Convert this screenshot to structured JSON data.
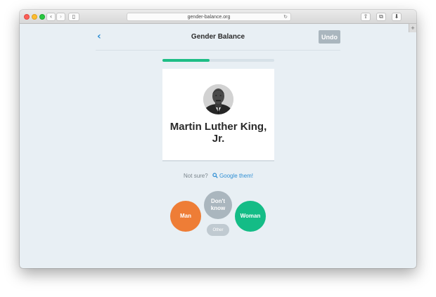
{
  "browser": {
    "url": "gender-balance.org",
    "back_glyph": "‹",
    "forward_glyph": "›",
    "sidebar_glyph": "▯",
    "reload_glyph": "↻",
    "share_glyph": "⇧",
    "tabs_glyph": "⧉",
    "download_glyph": "⬇",
    "new_tab_glyph": "+"
  },
  "header": {
    "back_glyph": "‹",
    "title": "Gender Balance",
    "undo_label": "Undo"
  },
  "progress": {
    "fraction": 0.42,
    "color": "#1ebe86"
  },
  "card": {
    "name": "Martin Luther King, Jr."
  },
  "help": {
    "not_sure": "Not sure?",
    "google_label": "Google them!"
  },
  "choices": {
    "man_label": "Man",
    "dont_know_label": "Don't know",
    "woman_label": "Woman",
    "other_label": "Other"
  },
  "colors": {
    "man": "#ee7d36",
    "woman": "#14bc86",
    "dont_know": "#aab6be",
    "link": "#2f8fd4"
  },
  "icons": [
    "back-chevron-icon",
    "search-icon",
    "share-icon",
    "tabs-icon",
    "download-icon"
  ]
}
